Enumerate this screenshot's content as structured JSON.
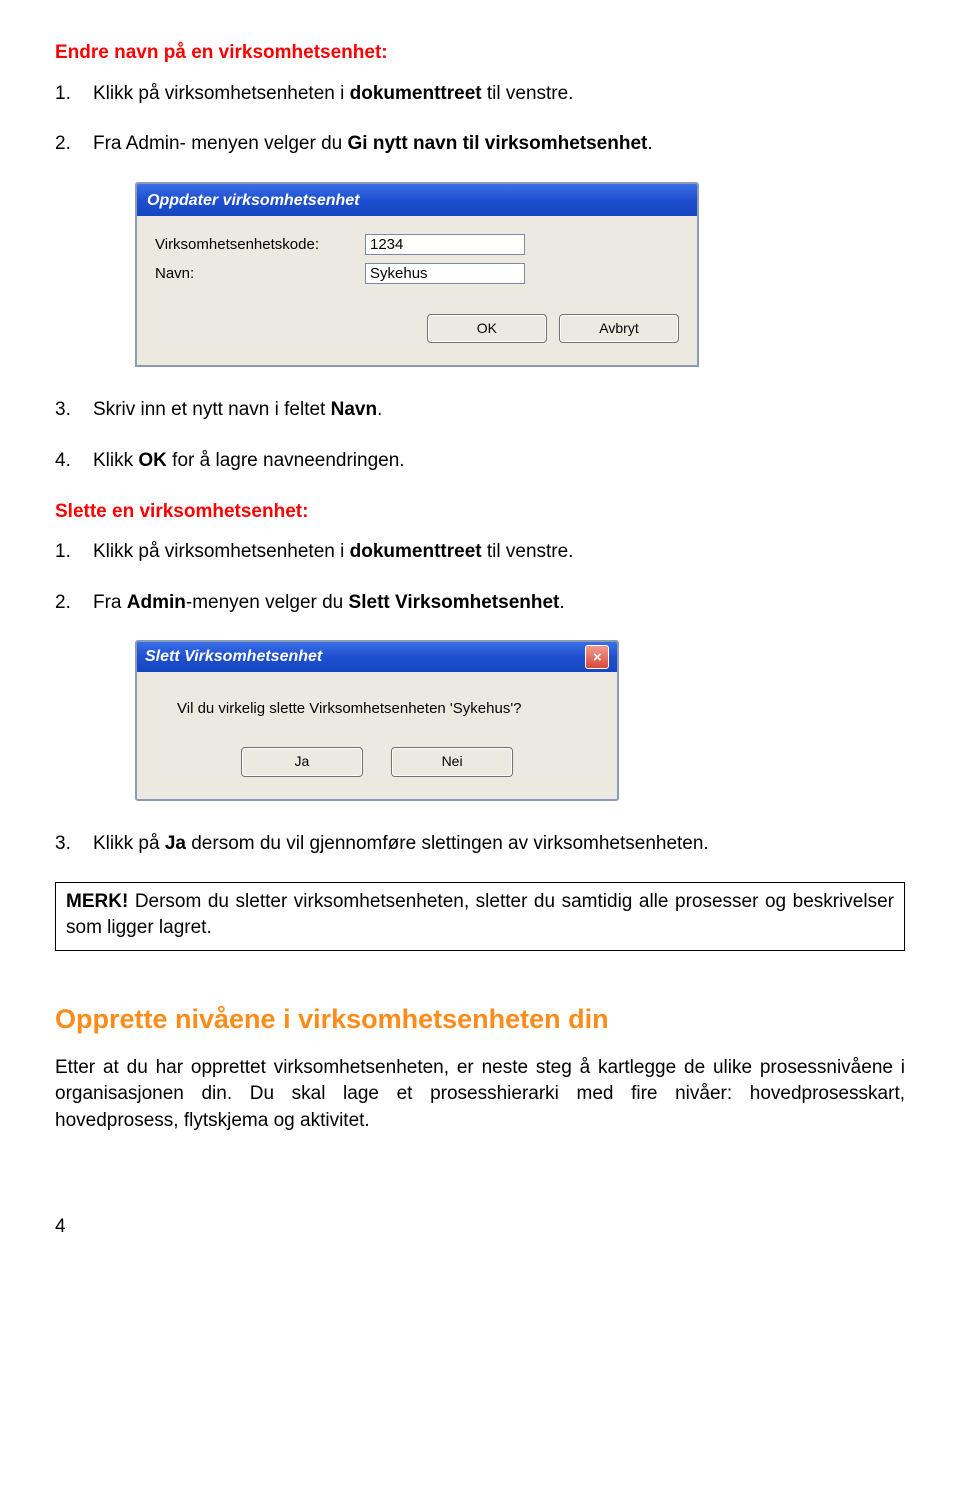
{
  "headings": {
    "rename": "Endre navn på en virksomhetsenhet:",
    "delete": "Slette en virksomhetsenhet:",
    "section": "Opprette nivåene i virksomhetsenheten din"
  },
  "steps_rename": [
    {
      "num": "1.",
      "pre": "Klikk på virksomhetsenheten i ",
      "bold": "dokumenttreet",
      "post": " til venstre."
    },
    {
      "num": "2.",
      "pre": "Fra Admin- menyen velger du ",
      "bold": "Gi nytt navn til virksomhetsenhet",
      "post": "."
    }
  ],
  "steps_rename_after": [
    {
      "num": "3.",
      "pre": "Skriv inn et nytt navn i feltet ",
      "bold": "Navn",
      "post": "."
    },
    {
      "num": "4.",
      "pre": "Klikk ",
      "bold": "OK",
      "post": " for å lagre navneendringen."
    }
  ],
  "steps_delete": [
    {
      "num": "1.",
      "pre": "Klikk på virksomhetsenheten i ",
      "bold": "dokumenttreet",
      "post": " til venstre."
    },
    {
      "num": "2.",
      "pre": "Fra ",
      "bold": "Admin",
      "mid": "-menyen velger du ",
      "bold2": "Slett Virksomhetsenhet",
      "post": "."
    }
  ],
  "steps_delete_after": [
    {
      "num": "3.",
      "pre": "Klikk på ",
      "bold": "Ja",
      "post": " dersom du vil gjennomføre slettingen av virksomhetsenheten."
    }
  ],
  "merk": {
    "label": "MERK!",
    "text": " Dersom du sletter virksomhetsenheten, sletter du samtidig alle prosesser og beskrivelser som ligger lagret."
  },
  "section_body": "Etter at du har opprettet virksomhetsenheten, er neste steg å kartlegge de ulike prosessnivåene i organisasjonen din. Du skal lage et prosesshierarki med fire nivåer: hovedprosesskart, hovedprosess, flytskjema og aktivitet.",
  "page_number": "4",
  "dialog1": {
    "title": "Oppdater virksomhetsenhet",
    "label_code": "Virksomhetsenhetskode:",
    "label_name": "Navn:",
    "value_code": "1234",
    "value_name": "Sykehus",
    "btn_ok": "OK",
    "btn_cancel": "Avbryt"
  },
  "dialog2": {
    "title": "Slett Virksomhetsenhet",
    "message": "Vil du virkelig slette Virksomhetsenheten 'Sykehus'?",
    "btn_yes": "Ja",
    "btn_no": "Nei",
    "close_glyph": "×"
  }
}
